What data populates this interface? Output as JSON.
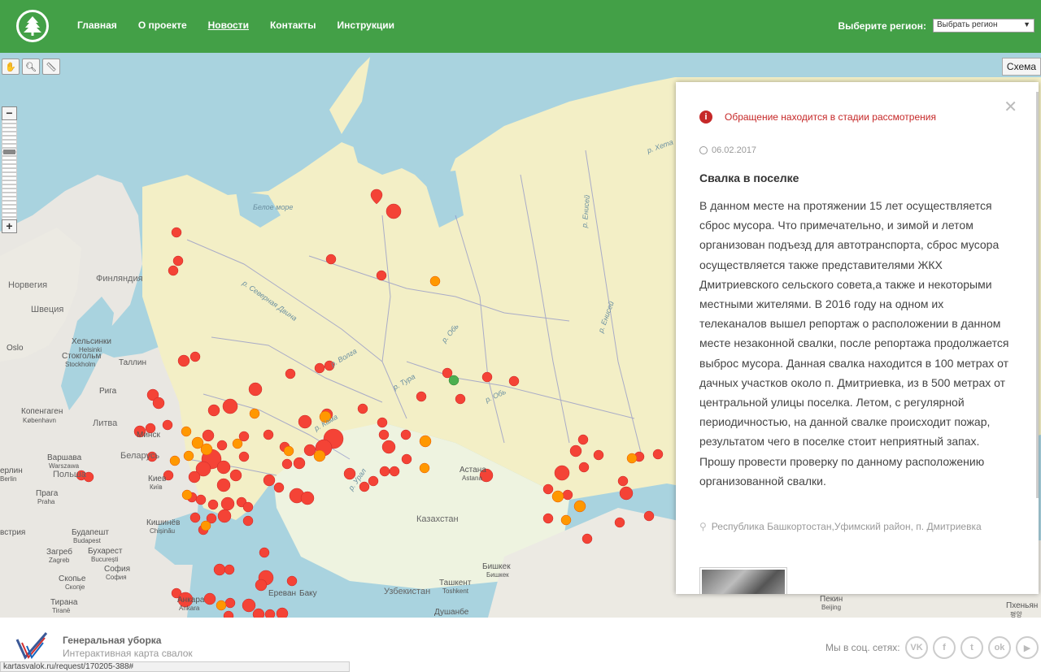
{
  "header": {
    "nav": [
      "Главная",
      "О проекте",
      "Новости",
      "Контакты",
      "Инструкции"
    ],
    "region_label": "Выберите регион:",
    "region_value": "Выбрать регион"
  },
  "map": {
    "scheme_button": "Схема",
    "labels": {
      "norway": "Норвегия",
      "finland": "Финляндия",
      "sweden": "Швеция",
      "helsinki": "Хельсинки",
      "helsinki_lat": "Helsinki",
      "stockholm": "Стокгольм",
      "stockholm_lat": "Stockholm",
      "oslo": "Oslo",
      "tallinn": "Таллин",
      "riga": "Рига",
      "copenhagen": "Копенгаген",
      "copenhagen_lat": "København",
      "lithuania": "Литва",
      "minsk": "Минск",
      "belarus": "Беларусь",
      "warsaw": "Варшава",
      "warsaw_lat": "Warszawa",
      "poland": "Польша",
      "berlin": "ерлин",
      "berlin_lat": "Berlin",
      "prague": "Прага",
      "prague_lat": "Praha",
      "kyiv": "Киев",
      "kyiv_lat": "Київ",
      "chisinau": "Кишинёв",
      "chisinau_lat": "Chișinău",
      "budapest": "Будапешт",
      "budapest_lat": "Budapest",
      "bucharest": "Бухарест",
      "bucharest_lat": "București",
      "zagreb": "Загреб",
      "zagreb_lat": "Zagreb",
      "sofia": "София",
      "sofia_lat": "София",
      "skopje": "Скопье",
      "skopje_lat": "Скопје",
      "tirana": "Тирана",
      "tirana_lat": "Tiranë",
      "austria": "встрия",
      "ankara": "Анкара",
      "ankara_lat": "Ankara",
      "yerevan": "Ереван",
      "baku": "Баку",
      "kazakhstan": "Казахстан",
      "astana": "Астана",
      "astana_lat": "Astana",
      "uzbekistan": "Узбекистан",
      "tashkent": "Ташкент",
      "tashkent_lat": "Toshkent",
      "bishkek": "Бишкек",
      "bishkek_lat": "Бишкек",
      "dushanbe": "Душанбе",
      "beijing": "Пекин",
      "beijing_lat": "Beijing",
      "pyongyang": "Пхеньян",
      "pyongyang_lat": "평양",
      "white_sea": "Белое море",
      "ob1": "р. Обь",
      "ob2": "р. Обь",
      "ural": "р. Урал",
      "kama": "р. Кама",
      "tura": "р. Тура",
      "sev_dvina": "р. Северная Двина",
      "volga": "р. Волга",
      "khet": "р. Хета",
      "yenisei": "р. Енисей",
      "yenisei2": "р. Енисей"
    }
  },
  "panel": {
    "status": "Обращение находится в стадии рассмотрения",
    "date": "06.02.2017",
    "title": "Свалка в поселке",
    "description": "В данном месте на протяжении 15 лет осуществляется сброс мусора. Что примечательно, и зимой и летом организован подъезд для автотранспорта, сброс мусора осуществляется также представителями ЖКХ Дмитриевского сельского совета,а также и некоторыми местными жителями. В 2016 году на одном их телеканалов вышел репортаж о расположении в данном месте незаконной свалки, после репортажа продолжается выброс мусора. Данная свалка находится в 100 метрах от дачных участков около п. Дмитриевка, из в 500 метрах от центральной улицы поселка. Летом, с регулярной периодичностью, на данной свалке происходит пожар, результатом чего в поселке стоит неприятный запах. Прошу провести проверку по данному расположению организованной свалки.",
    "address": "Республика Башкортостан,Уфимский район, п. Дмитриевка"
  },
  "footer": {
    "title": "Генеральная уборка",
    "subtitle": "Интерактивная карта свалок",
    "social_label": "Мы в соц. сетях:",
    "socials": [
      "VK",
      "f",
      "t",
      "ok",
      "▶"
    ],
    "status_url": "kartasvalok.ru/request/170205-388#"
  },
  "colors": {
    "header": "#43a047",
    "marker_red": "#f44336",
    "marker_orange": "#ff9800",
    "marker_green": "#4caf50",
    "russia": "#f3efc6",
    "water": "#a9d3df"
  }
}
